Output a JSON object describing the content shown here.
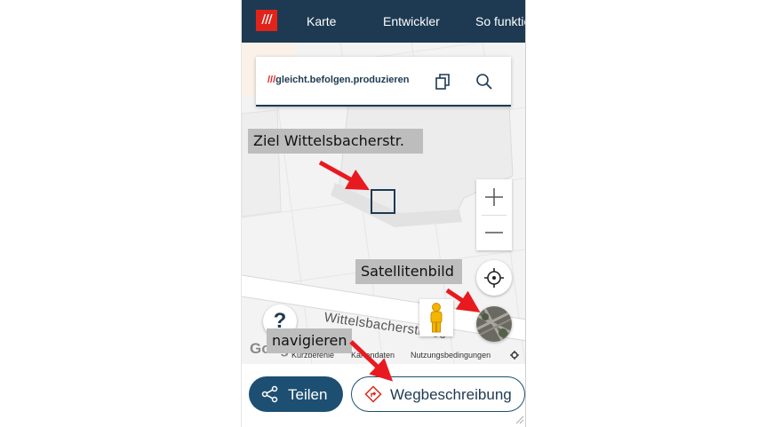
{
  "nav": {
    "logo": "///",
    "links": [
      "Karte",
      "Entwickler",
      "So funktio"
    ]
  },
  "search": {
    "slashes": "///",
    "address": "gleicht.befolgen.produzieren"
  },
  "map": {
    "street_label": "Wittelsbacherstraße",
    "google": "Google",
    "attribution": [
      "Kurzbefehle",
      "Kartendaten",
      "Nutzungsbedingungen"
    ],
    "help_label": "?"
  },
  "buttons": {
    "share": "Teilen",
    "route": "Wegbeschreibung"
  },
  "annotations": {
    "target": "Ziel Wittelsbacherstr.",
    "satellite": "Satellitenbild",
    "navigate": "navigieren"
  },
  "colors": {
    "brand_red": "#e2231a",
    "navy": "#1d3a52",
    "button_blue": "#1d4f72",
    "arrow_red": "#e8191f"
  }
}
